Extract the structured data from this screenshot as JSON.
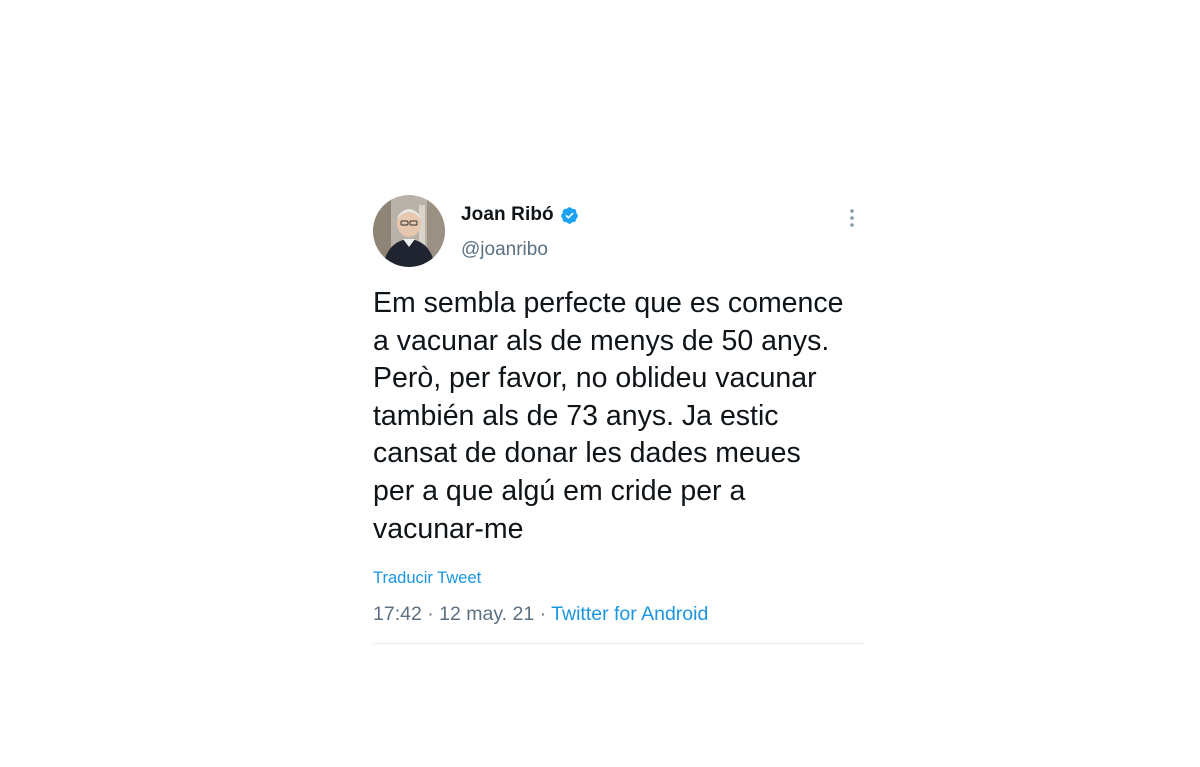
{
  "tweet": {
    "display_name": "Joan Ribó",
    "handle": "@joanribo",
    "verified_icon": "verified-badge-icon",
    "more_icon": "more-options-icon",
    "text": "Em sembla perfecte que es comence\na vacunar als de menys de 50 anys.\nPerò, per favor, no oblideu vacunar\ntambién als de 73 anys. Ja estic\ncansat de donar les dades meues\nper a que algú em cride per a\nvacunar-me",
    "translate_label": "Traducir Tweet",
    "time": "17:42",
    "separator": " · ",
    "date": "12 may. 21",
    "source": "Twitter for Android"
  },
  "colors": {
    "text": "#0f1419",
    "secondary": "#5b7083",
    "link": "#1b95e0",
    "verified": "#1da1f2",
    "divider": "#e6ecf0"
  }
}
